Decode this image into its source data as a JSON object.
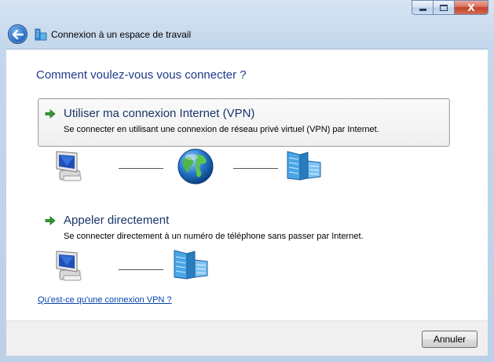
{
  "window": {
    "title": "Connexion à un espace de travail",
    "caption": {
      "minimize_icon": "minimize-icon",
      "maximize_icon": "maximize-icon",
      "close_glyph": "X"
    }
  },
  "heading": "Comment voulez-vous vous connecter ?",
  "options": [
    {
      "title": "Utiliser ma connexion Internet (VPN)",
      "description": "Se connecter en utilisant une connexion de réseau privé virtuel (VPN) par Internet.",
      "diagram": [
        "computer-icon",
        "internet-globe-icon",
        "workplace-building-icon"
      ]
    },
    {
      "title": "Appeler directement",
      "description": "Se connecter directement à un numéro de téléphone sans passer par Internet.",
      "diagram": [
        "computer-icon",
        "workplace-building-icon"
      ]
    }
  ],
  "help_link": "Qu'est-ce qu'une connexion VPN ?",
  "footer": {
    "cancel_label": "Annuler"
  },
  "colors": {
    "heading": "#1e3a8a",
    "link": "#0645ad",
    "arrow": "#2e9e2e"
  }
}
